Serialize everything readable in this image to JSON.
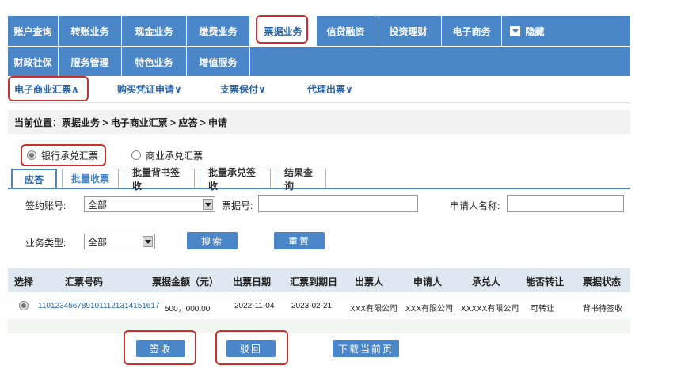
{
  "nav": {
    "row1": [
      "账户查询",
      "转账业务",
      "现金业务",
      "缴费业务",
      "票据业务",
      "信贷融资",
      "投资理财",
      "电子商务",
      "隐藏"
    ],
    "row2": [
      "财政社保",
      "服务管理",
      "特色业务",
      "增值服务"
    ]
  },
  "subnav": [
    "电子商业汇票∧",
    "购买凭证申请∨",
    "支票保付∨",
    "代理出票∨"
  ],
  "breadcrumb": "当前位置：票据业务 > 电子商业汇票 > 应答 > 申请",
  "radios": {
    "bank": "银行承兑汇票",
    "commercial": "商业承兑汇票"
  },
  "tabs": [
    "应答",
    "批量收票",
    "批量背书签收",
    "批量承兑签收",
    "结果查询"
  ],
  "form": {
    "account_label": "签约账号:",
    "account_value": "全部",
    "bill_no_label": "票据号:",
    "applicant_label": "申请人名称:",
    "biz_type_label": "业务类型:",
    "biz_type_value": "全部",
    "search_btn": "搜索",
    "reset_btn": "重置"
  },
  "table": {
    "headers": [
      "选择",
      "汇票号码",
      "票据金额（元）",
      "出票日期",
      "汇票到期日",
      "出票人",
      "申请人",
      "承兑人",
      "能否转让",
      "票据状态"
    ],
    "rows": [
      [
        "110123456789101112131415161​7",
        "500，000.00",
        "2022-11-04",
        "2023-02-21",
        "XXX有限公司",
        "XXX有限公司",
        "XXXXX有限公司",
        "可转让",
        "背书待签收"
      ]
    ]
  },
  "actions": {
    "sign": "签收",
    "reject": "驳回",
    "download": "下载当前页"
  },
  "colors": {
    "nav_blue": "#4a86c8",
    "highlight_red": "#c9302c",
    "link_blue": "#2a63a8"
  }
}
